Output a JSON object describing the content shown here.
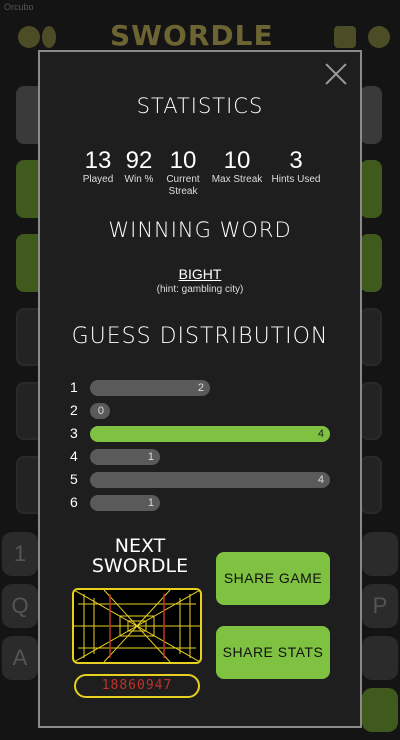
{
  "background": {
    "status_text": "Orcubo",
    "logo": "SWORDLE",
    "keys": [
      "1",
      "Q",
      "A",
      "P"
    ]
  },
  "modal": {
    "title": "STATISTICS",
    "stats": [
      {
        "value": "13",
        "label": "Played"
      },
      {
        "value": "92",
        "label": "Win %"
      },
      {
        "value": "10",
        "label": "Current Streak"
      },
      {
        "value": "10",
        "label": "Max Streak"
      },
      {
        "value": "3",
        "label": "Hints Used"
      }
    ],
    "winning_word_title": "WINNING WORD",
    "winning_word": "BIGHT",
    "hint": "(hint: gambling city)",
    "distribution_title": "GUESS DISTRIBUTION",
    "distribution": [
      {
        "guess": "1",
        "count": "2",
        "fraction": 0.5
      },
      {
        "guess": "2",
        "count": "0",
        "fraction": 0.08
      },
      {
        "guess": "3",
        "count": "4",
        "fraction": 1.0,
        "current": true
      },
      {
        "guess": "4",
        "count": "1",
        "fraction": 0.29
      },
      {
        "guess": "5",
        "count": "4",
        "fraction": 1.0
      },
      {
        "guess": "6",
        "count": "1",
        "fraction": 0.29
      }
    ],
    "next_title": "NEXT SWORDLE",
    "countdown": "18860947",
    "share_game_label": "SHARE GAME",
    "share_stats_label": "SHARE STATS"
  },
  "colors": {
    "accent": "#7fc241",
    "bar": "#5a5a5a",
    "radar": "#e8d020",
    "countdown": "#c0322b"
  }
}
